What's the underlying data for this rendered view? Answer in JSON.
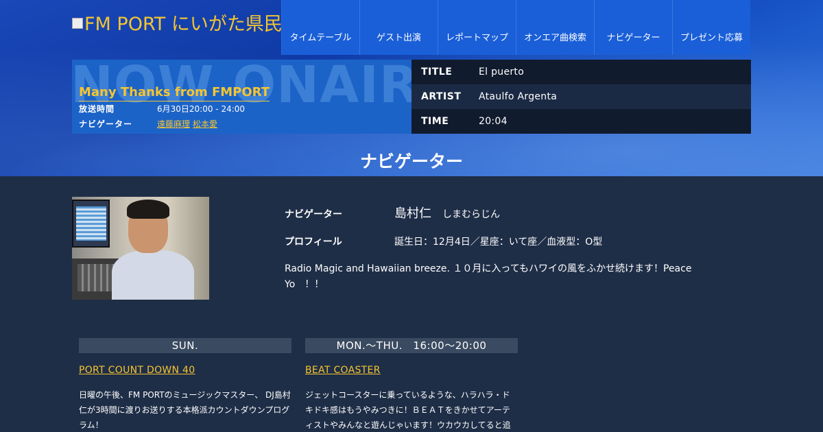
{
  "header": {
    "logo_alt": "FM PORT にいがた県民エフエム放送"
  },
  "nav": {
    "items": [
      "タイムテーブル",
      "ゲスト出演",
      "レポートマップ",
      "オンエア曲検索",
      "ナビゲーター",
      "プレゼント応募"
    ]
  },
  "onair": {
    "bg_text": "NOW ONAIR",
    "program_title": "Many Thanks from FMPORT",
    "time_label": "放送時間",
    "time_value": "6月30日20:00 - 24:00",
    "navigator_label": "ナビゲーター",
    "navigators": [
      "遠藤麻理",
      "松本愛"
    ],
    "track": {
      "title_label": "TITLE",
      "title": "El puerto",
      "artist_label": "ARTIST",
      "artist": "Ataulfo Argenta",
      "time_label": "TIME",
      "time": "20:04"
    }
  },
  "page": {
    "title": "ナビゲーター"
  },
  "navigator": {
    "label": "ナビゲーター",
    "name": "島村仁",
    "kana": "しまむらじん",
    "profile_label": "プロフィール",
    "profile": "誕生日：12月4日／星座：いて座／血液型：O型",
    "description": "Radio Magic and Hawaiian breeze. １０月に入ってもハワイの風をふかせ続けます！Peace Yo　！！"
  },
  "programs": [
    {
      "day": "SUN.",
      "name": "PORT COUNT DOWN 40",
      "text": "日曜の午後、FM PORTのミュージックマスター、 DJ島村仁が3時間に渡りお送りする本格派カウントダウンプログラム！"
    },
    {
      "day": "MON.～THU.　16:00～20:00",
      "name": "BEAT COASTER",
      "text": "ジェットコースターに乗っているような、ハラハラ・ドキドキ感はもうやみつきに！ＢＥＡＴをきかせてアーティストやみんなと遊んじゃいます！ウカウカしてると追"
    }
  ],
  "colors": {
    "accent": "#f5c531",
    "nav_bg": "#1a5fd8",
    "content_bg": "#1f2e47"
  }
}
